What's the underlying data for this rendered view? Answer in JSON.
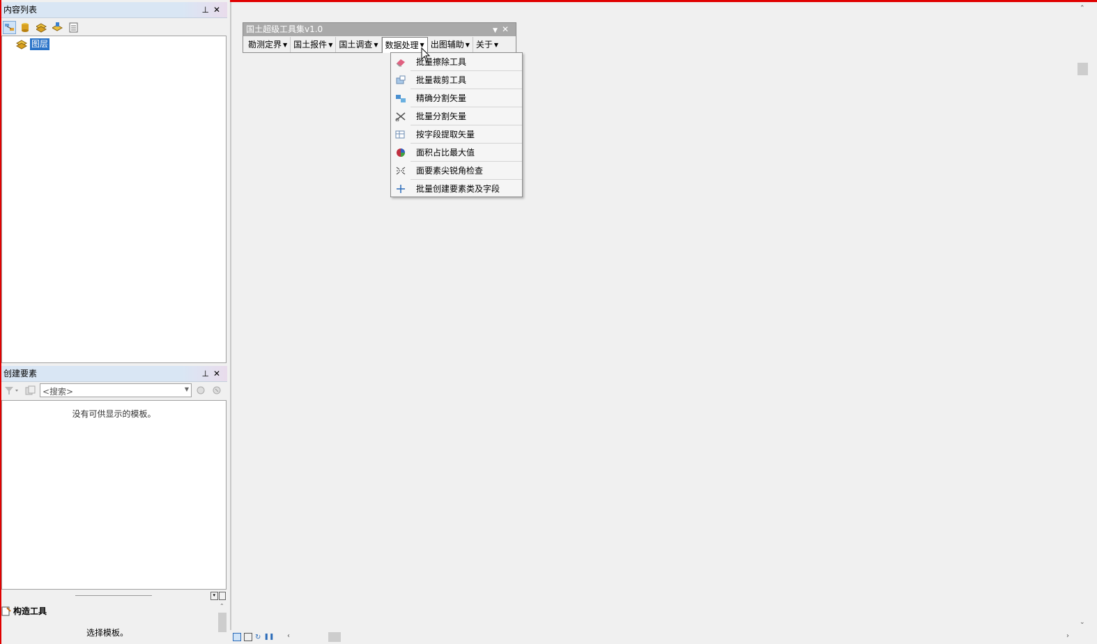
{
  "toc": {
    "title": "内容列表",
    "layer_label": "图层"
  },
  "create_features": {
    "title": "创建要素",
    "search_placeholder": "<搜索>",
    "empty_message": "没有可供显示的模板。"
  },
  "construct_tools": {
    "title": "构造工具",
    "message": "选择模板。"
  },
  "toolbar_window": {
    "title": "国土超级工具集v1.0",
    "menus": [
      "勘测定界",
      "国土报件",
      "国土调查",
      "数据处理",
      "出图辅助",
      "关于"
    ]
  },
  "dropdown": {
    "items": [
      {
        "label": "批量擦除工具",
        "icon": "eraser-icon"
      },
      {
        "label": "批量裁剪工具",
        "icon": "clip-icon"
      },
      {
        "label": "精确分割矢量",
        "icon": "precise-split-icon"
      },
      {
        "label": "批量分割矢量",
        "icon": "batch-split-icon"
      },
      {
        "label": "按字段提取矢量",
        "icon": "field-extract-icon"
      },
      {
        "label": "面积占比最大值",
        "icon": "pie-icon"
      },
      {
        "label": "面要素尖锐角检查",
        "icon": "sharp-angle-icon"
      },
      {
        "label": "批量创建要素类及字段",
        "icon": "plus-icon"
      }
    ]
  }
}
